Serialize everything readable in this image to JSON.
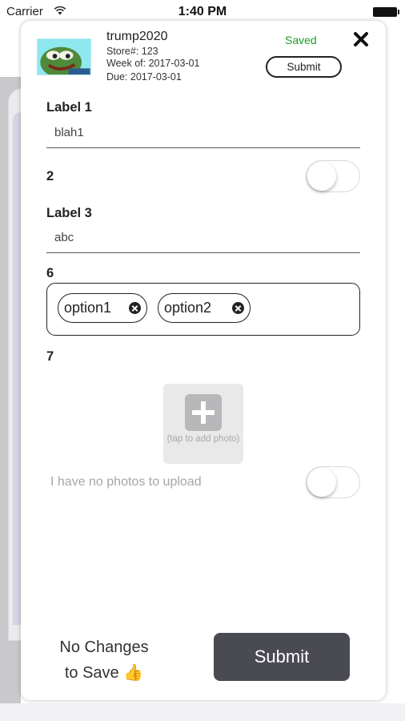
{
  "status_bar": {
    "carrier": "Carrier",
    "time": "1:40 PM"
  },
  "header": {
    "user_name": "trump2020",
    "store": "Store#: 123",
    "week_of": "Week of: 2017-03-01",
    "due": "Due: 2017-03-01",
    "saved_status": "Saved",
    "submit_label": "Submit"
  },
  "fields": {
    "label1": {
      "label": "Label 1",
      "value": "blah1"
    },
    "field2": {
      "label": "2",
      "toggle_on": false
    },
    "label3": {
      "label": "Label 3",
      "value": "abc"
    },
    "field6": {
      "label": "6",
      "tags": [
        "option1",
        "option2"
      ]
    },
    "field7": {
      "label": "7",
      "photo_hint": "(tap to add photo)",
      "no_photos_label": "I have no photos to upload",
      "no_photos_toggle_on": false
    }
  },
  "footer": {
    "status_line1": "No Changes",
    "status_line2": "to Save",
    "status_emoji": "👍",
    "submit_label": "Submit"
  },
  "icons": {
    "avatar": "frog-avatar",
    "close": "close-icon",
    "wifi": "wifi-icon",
    "battery": "battery-icon",
    "add_photo": "plus-icon",
    "chip_remove": "remove-circle-icon"
  },
  "colors": {
    "saved": "#1e9c2a",
    "submit_button": "#4a4a52"
  }
}
